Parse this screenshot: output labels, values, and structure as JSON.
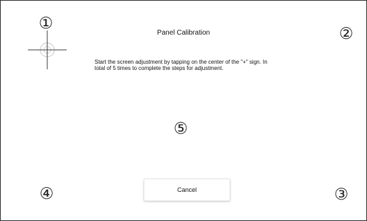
{
  "dialog": {
    "title": "Panel Calibration",
    "instructions": "Start the screen adjustment by tapping on the center of the \"+\" sign. In total of 5 times to complete the steps for adjustment.",
    "cancel_label": "Cancel"
  },
  "markers": {
    "m1": "①",
    "m2": "②",
    "m3": "③",
    "m4": "④",
    "m5": "⑤"
  },
  "icons": {
    "target": "crosshair-icon"
  }
}
